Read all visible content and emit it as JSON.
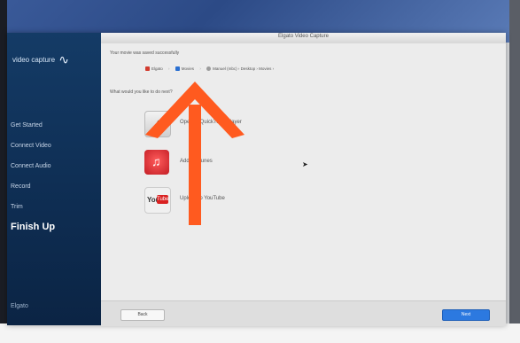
{
  "window": {
    "title": "Elgato Video Capture"
  },
  "sidebar": {
    "brand": "video capture",
    "brand_wave": "∿",
    "items": [
      {
        "label": "Get Started"
      },
      {
        "label": "Connect Video"
      },
      {
        "label": "Connect Audio"
      },
      {
        "label": "Record"
      },
      {
        "label": "Trim"
      },
      {
        "label": "Finish Up",
        "active": true
      }
    ],
    "footer": "Elgato"
  },
  "main": {
    "question1": "Your movie was saved successfully",
    "route": {
      "step1": "Elgato",
      "step2": "Movies",
      "step3": "Manuel (mbc) › Desktop › Movies ›"
    },
    "question2": "What would you like to do next?",
    "options": [
      {
        "label": "Open in QuickTime Player",
        "icon": "photos-icon"
      },
      {
        "label": "Add to iTunes",
        "icon": "itunes-icon"
      },
      {
        "label": "Upload to YouTube",
        "icon": "youtube-icon"
      }
    ]
  },
  "footer": {
    "back_label": "Back",
    "next_label": "Next"
  },
  "colors": {
    "sidebar": "#0f2f55",
    "accent_button": "#2c79e0",
    "annotation_arrow": "#ff5a1f"
  }
}
